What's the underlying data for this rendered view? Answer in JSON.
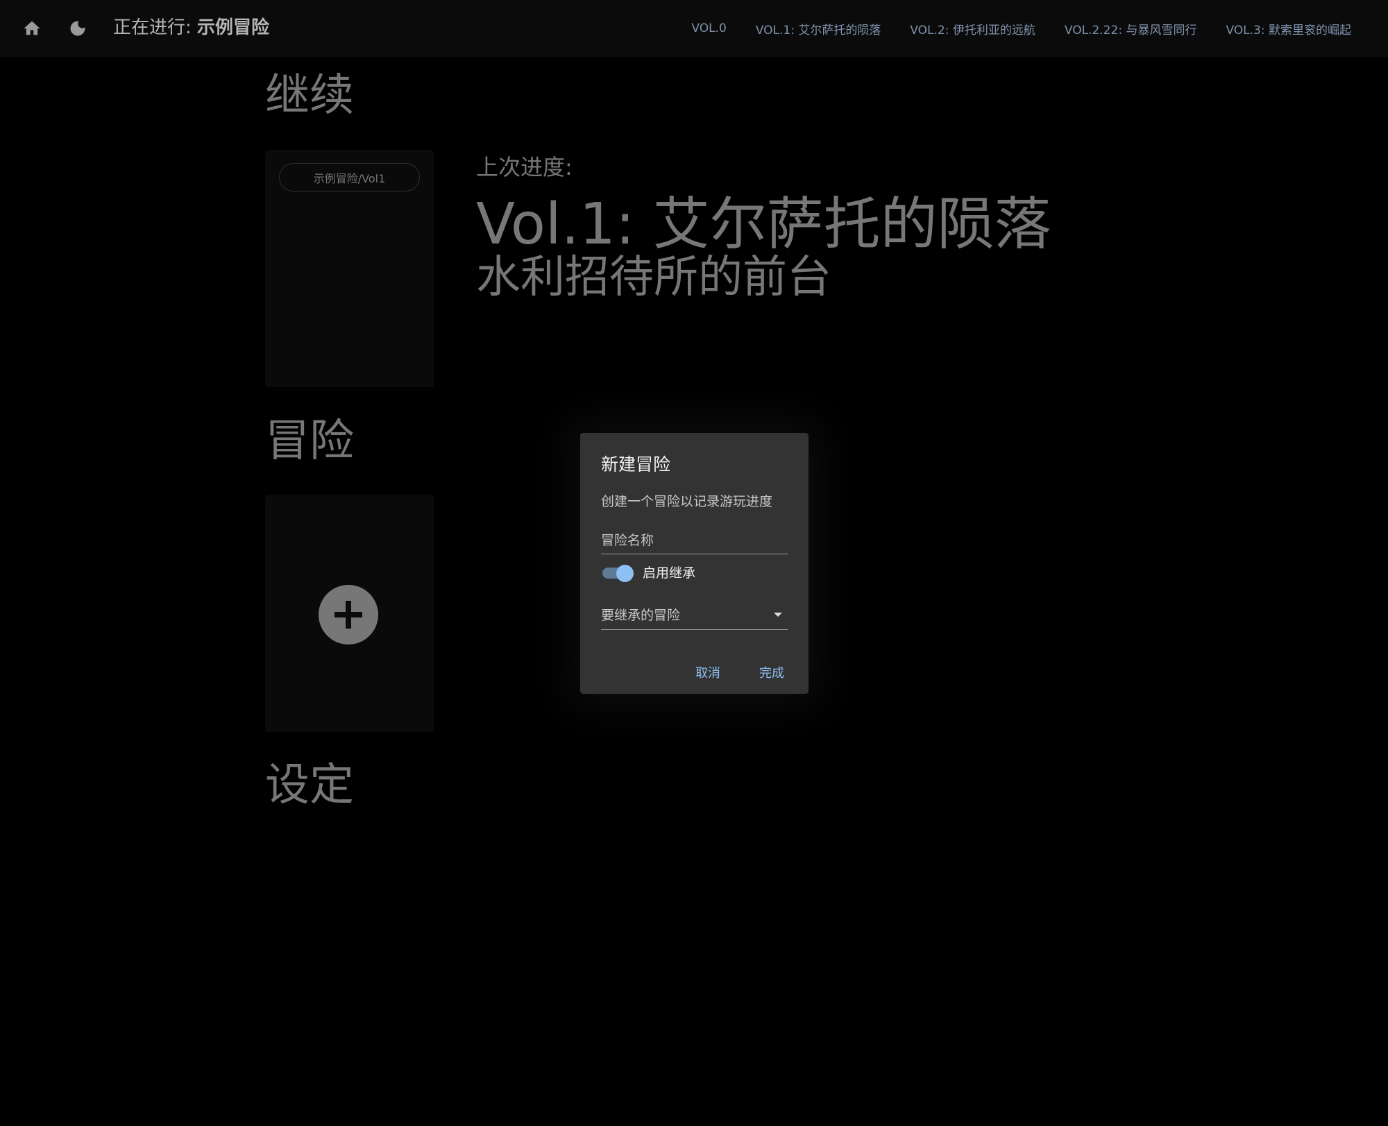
{
  "header": {
    "title_prefix": "正在进行: ",
    "title_adventure": "示例冒险",
    "nav": [
      "VOL.0",
      "VOL.1: 艾尔萨托的陨落",
      "VOL.2: 伊托利亚的远航",
      "VOL.2.22: 与暴风雪同行",
      "VOL.3: 默索里衮的崛起"
    ]
  },
  "continue_section": {
    "title": "继续",
    "card_chip": "示例冒险/Vol1",
    "last_label": "上次进度:",
    "last_volume": "Vol.1: 艾尔萨托的陨落",
    "last_scene": "水利招待所的前台"
  },
  "adventure_section": {
    "title": "冒险"
  },
  "settings_section": {
    "title": "设定"
  },
  "dialog": {
    "title": "新建冒险",
    "description": "创建一个冒险以记录游玩进度",
    "name_field_label": "冒险名称",
    "inherit_switch_label": "启用继承",
    "inherit_enabled": true,
    "inherit_select_label": "要继承的冒险",
    "cancel_label": "取消",
    "done_label": "完成"
  },
  "icons": {
    "home": "home-icon",
    "theme": "moon-icon",
    "add": "plus-icon",
    "dropdown": "caret-down-icon"
  },
  "colors": {
    "accent": "#8dbff3",
    "nav_text": "#7f93ad",
    "dialog_bg": "#333333"
  }
}
